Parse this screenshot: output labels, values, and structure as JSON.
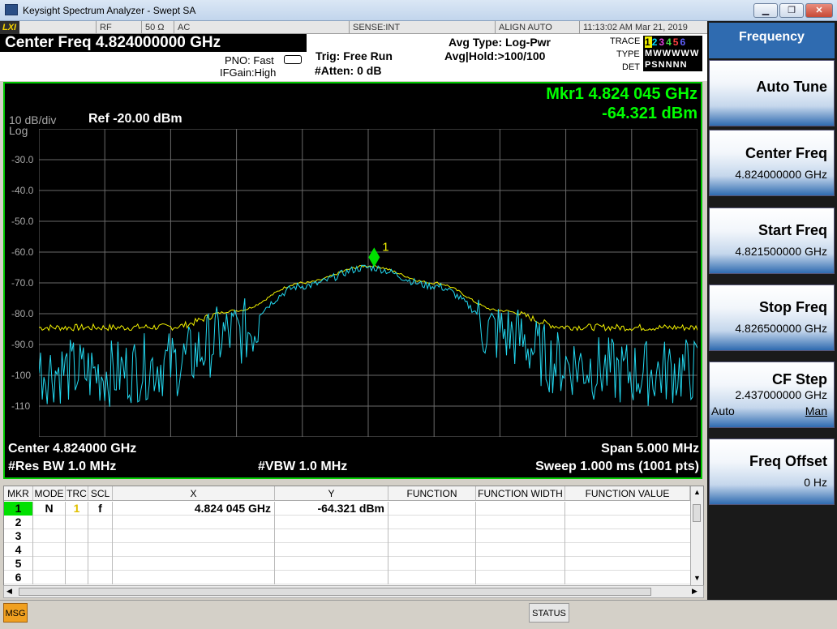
{
  "window": {
    "title": "Keysight Spectrum Analyzer - Swept SA",
    "controls": [
      "▁",
      "❐",
      "✕"
    ]
  },
  "statusbar": {
    "logo": "LXI",
    "rf": "RF",
    "impedance": "50 Ω",
    "coupling": "AC",
    "sense": "SENSE:INT",
    "align": "ALIGN AUTO",
    "datetime": "11:13:02 AM Mar 21, 2019"
  },
  "header": {
    "center_freq": "Center Freq 4.824000000 GHz",
    "pno": "PNO: Fast",
    "ifgain": "IFGain:High",
    "trig": "Trig: Free Run",
    "atten": "#Atten: 0 dB",
    "avg_type": "Avg Type: Log-Pwr",
    "avg_hold": "Avg|Hold:>100/100",
    "trace_label": "TRACE",
    "type_label": "TYPE",
    "det_label": "DET",
    "trace_nums": [
      "1",
      "2",
      "3",
      "4",
      "5",
      "6"
    ],
    "trace_colors": [
      "#f0f000",
      "#00d8ff",
      "#e040e0",
      "#40e040",
      "#ff4040",
      "#6060ff"
    ],
    "type_value": "M W W W W W",
    "det_value": "P S N N N N"
  },
  "plot": {
    "scale": "10 dB/div",
    "log": "Log",
    "ref": "Ref -20.00 dBm",
    "marker_readout_1": "Mkr1 4.824 045 GHz",
    "marker_readout_2": "-64.321 dBm",
    "marker_label": "1",
    "center": "Center 4.824000 GHz",
    "span": "Span 5.000 MHz",
    "res_bw": "#Res BW 1.0 MHz",
    "vbw": "#VBW 1.0 MHz",
    "sweep": "Sweep  1.000 ms (1001 pts)",
    "colors": {
      "grid": "#6a6a6a",
      "border": "#00c800",
      "trace1": "#f0f000",
      "trace2": "#22d8f0",
      "marker": "#00e000",
      "readout": "#00ff00"
    }
  },
  "chart_data": {
    "type": "line",
    "title": "",
    "xlabel": "",
    "ylabel": "",
    "ylim": [
      -120,
      -20
    ],
    "y_ticks": [
      "-30.0",
      "-40.0",
      "-50.0",
      "-60.0",
      "-70.0",
      "-80.0",
      "-90.0",
      "-100",
      "-110"
    ],
    "x_range_ghz": [
      4.8215,
      4.8265
    ],
    "series": [
      {
        "name": "1",
        "color": "#f0f000",
        "x": [
          4.8215,
          4.822,
          4.8225,
          4.823,
          4.8235,
          4.824,
          4.8245,
          4.825,
          4.8255,
          4.826,
          4.8265
        ],
        "values": [
          -84.5,
          -84.5,
          -84.3,
          -79,
          -70,
          -64.5,
          -70,
          -79,
          -84.3,
          -84.5,
          -84.5
        ]
      },
      {
        "name": "2",
        "color": "#22d8f0",
        "x": [
          4.8215,
          4.822,
          4.8225,
          4.823,
          4.8235,
          4.824,
          4.8245,
          4.825,
          4.8255,
          4.826,
          4.8265
        ],
        "values": [
          -95,
          -96,
          -93,
          -83,
          -71,
          -65,
          -71,
          -83,
          -93,
          -96,
          -95
        ]
      }
    ],
    "marker": {
      "x": 4.824045,
      "y": -64.321
    }
  },
  "softkeys": {
    "header": "Frequency",
    "items": [
      {
        "label": "Auto Tune",
        "value": ""
      },
      {
        "label": "Center Freq",
        "value": "4.824000000 GHz"
      },
      {
        "label": "Start Freq",
        "value": "4.821500000 GHz"
      },
      {
        "label": "Stop Freq",
        "value": "4.826500000 GHz"
      },
      {
        "label": "CF Step",
        "value": "2.437000000 GHz",
        "auto": "Auto",
        "man": "Man"
      },
      {
        "label": "Freq Offset",
        "value": "0 Hz"
      }
    ]
  },
  "marker_table": {
    "headers": [
      "MKR",
      "MODE",
      "TRC",
      "SCL",
      "X",
      "Y",
      "FUNCTION",
      "FUNCTION WIDTH",
      "FUNCTION VALUE"
    ],
    "rows": [
      {
        "mkr": "1",
        "mode": "N",
        "trc": "1",
        "scl": "f",
        "x": "4.824 045 GHz",
        "y": "-64.321 dBm"
      },
      {
        "mkr": "2"
      },
      {
        "mkr": "3"
      },
      {
        "mkr": "4"
      },
      {
        "mkr": "5"
      },
      {
        "mkr": "6"
      }
    ]
  },
  "footer": {
    "msg": "MSG",
    "status": "STATUS"
  }
}
